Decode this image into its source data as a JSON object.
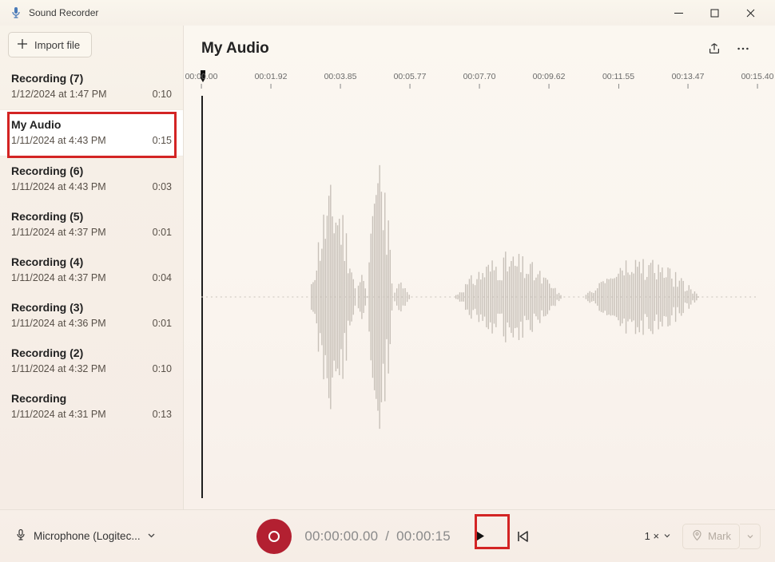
{
  "app": {
    "title": "Sound Recorder"
  },
  "window_controls": {
    "min": "min",
    "max": "max",
    "close": "close"
  },
  "sidebar": {
    "import_label": "Import file",
    "items": [
      {
        "title": "Recording (7)",
        "date": "1/12/2024 at 1:47 PM",
        "dur": "0:10"
      },
      {
        "title": "My Audio",
        "date": "1/11/2024 at 4:43 PM",
        "dur": "0:15",
        "selected": true,
        "highlighted": true
      },
      {
        "title": "Recording (6)",
        "date": "1/11/2024 at 4:43 PM",
        "dur": "0:03"
      },
      {
        "title": "Recording (5)",
        "date": "1/11/2024 at 4:37 PM",
        "dur": "0:01"
      },
      {
        "title": "Recording (4)",
        "date": "1/11/2024 at 4:37 PM",
        "dur": "0:04"
      },
      {
        "title": "Recording (3)",
        "date": "1/11/2024 at 4:36 PM",
        "dur": "0:01"
      },
      {
        "title": "Recording (2)",
        "date": "1/11/2024 at 4:32 PM",
        "dur": "0:10"
      },
      {
        "title": "Recording",
        "date": "1/11/2024 at 4:31 PM",
        "dur": "0:13"
      }
    ]
  },
  "main": {
    "title": "My Audio",
    "ruler": [
      "00:00.00",
      "00:01.92",
      "00:03.85",
      "00:05.77",
      "00:07.70",
      "00:09.62",
      "00:11.55",
      "00:13.47",
      "00:15.40"
    ]
  },
  "footer": {
    "mic_label": "Microphone (Logitec...",
    "current_time": "00:00:00.00",
    "sep": "/",
    "total_time": "00:00:15",
    "speed": "1 ×",
    "mark_label": "Mark"
  },
  "colors": {
    "accent_red": "#b32031",
    "highlight": "#d32424"
  }
}
